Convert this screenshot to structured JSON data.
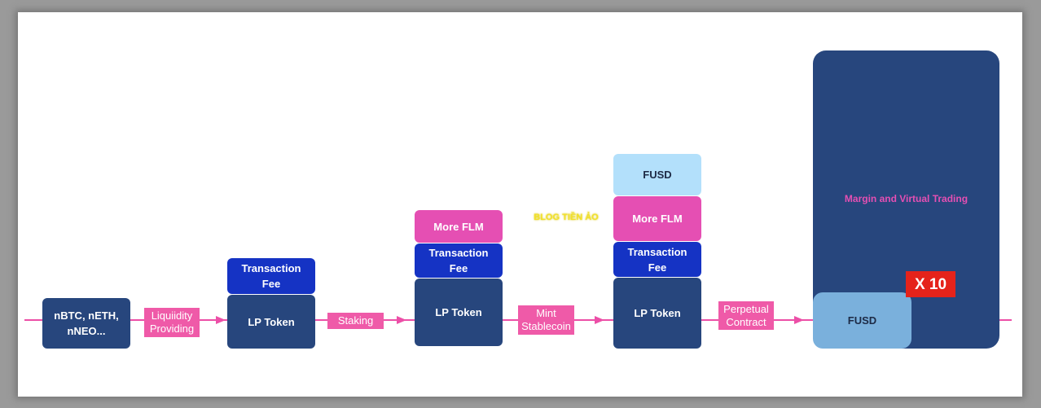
{
  "nodes": {
    "source": "nBTC, nETH,\nnNEO...",
    "lp1": "LP Token",
    "fee1": "Transaction\nFee",
    "lp2": "LP Token",
    "fee2": "Transaction\nFee",
    "flm2": "More FLM",
    "lp3": "LP Token",
    "fee3": "Transaction\nFee",
    "flm3": "More FLM",
    "fusd3": "FUSD",
    "margin": "Margin and Virtual Trading",
    "fusd4": "FUSD",
    "multiplier": "X 10"
  },
  "edges": {
    "e1": "Liquiidity\nProviding",
    "e2": "Staking",
    "e3": "Mint\nStablecoin",
    "e4": "Perpetual\nContract"
  },
  "watermark": "BLOG TIỀN ẢO",
  "colors": {
    "dark": "#27467d",
    "fee": "#1533c4",
    "flm": "#e54fb3",
    "fusd": "#b3e0fb",
    "arrow": "#ec4fa7",
    "multiplier": "#e5231b"
  }
}
